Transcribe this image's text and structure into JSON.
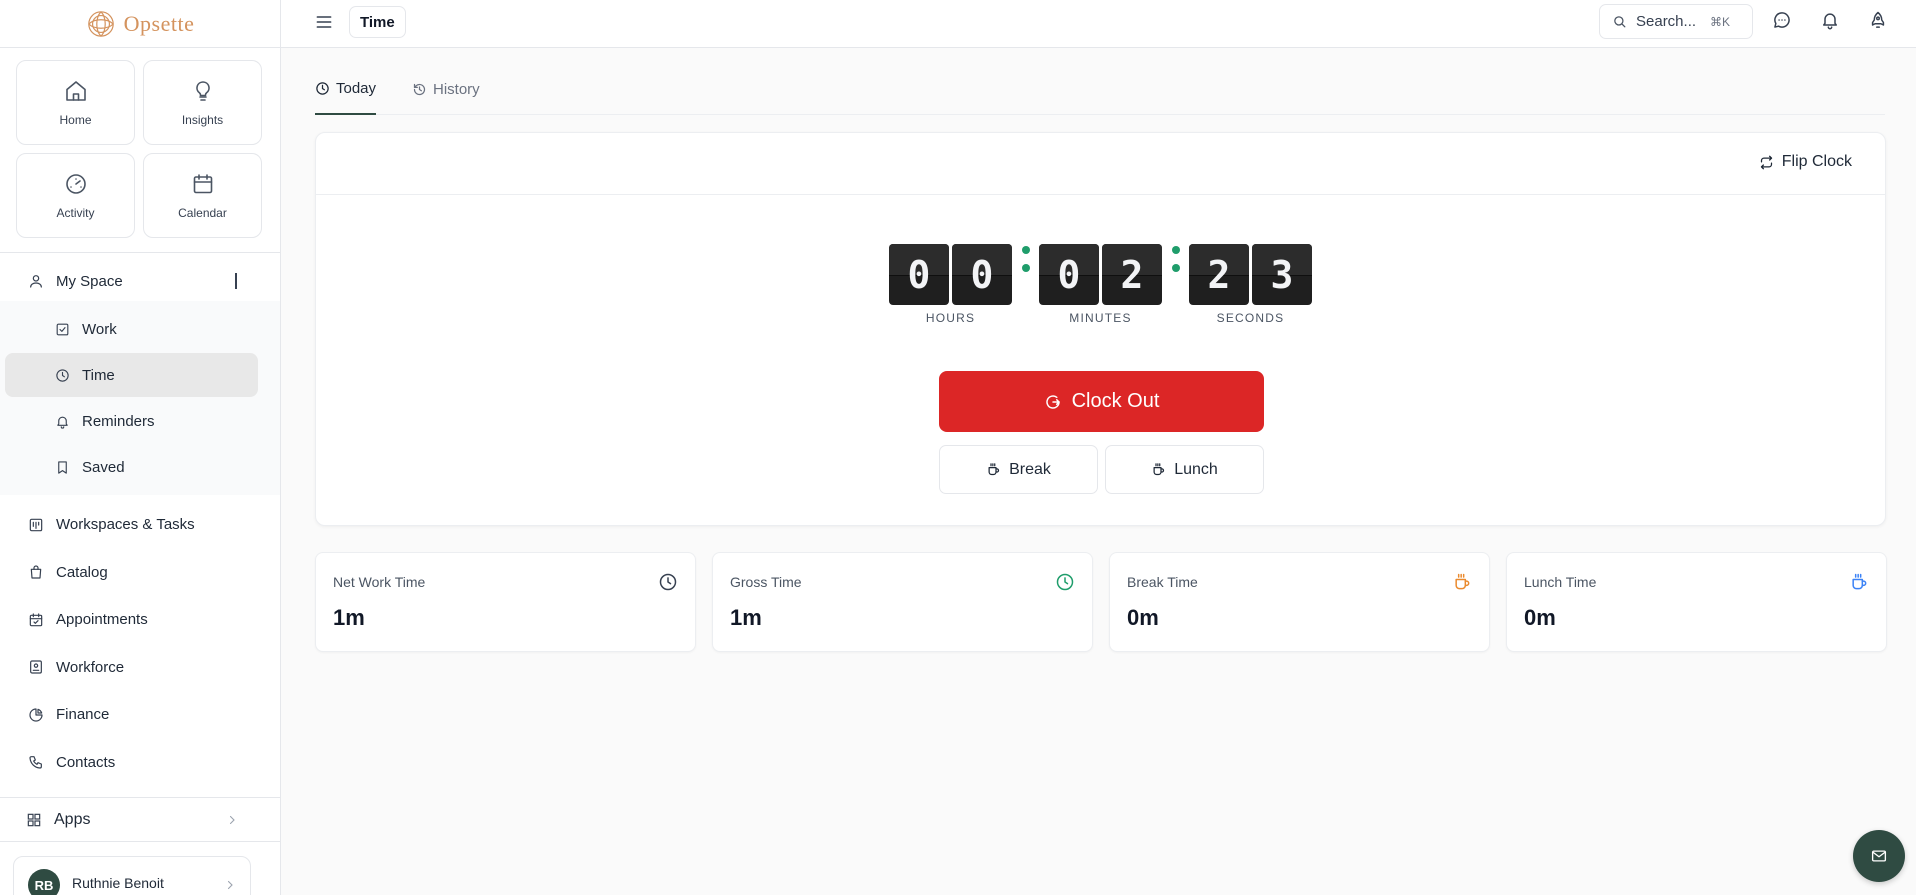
{
  "brand": {
    "name": "Opsette",
    "color": "#d4935e"
  },
  "topbar": {
    "page_title": "Time",
    "search_placeholder": "Search...",
    "search_shortcut": "⌘K"
  },
  "sidebar": {
    "quick": [
      {
        "label": "Home",
        "icon": "home-icon"
      },
      {
        "label": "Insights",
        "icon": "lightbulb-icon"
      },
      {
        "label": "Activity",
        "icon": "gauge-icon"
      },
      {
        "label": "Calendar",
        "icon": "calendar-icon"
      }
    ],
    "my_space": {
      "label": "My Space",
      "items": [
        {
          "label": "Work",
          "icon": "check-square-icon"
        },
        {
          "label": "Time",
          "icon": "clock-icon",
          "active": true
        },
        {
          "label": "Reminders",
          "icon": "bell-icon"
        },
        {
          "label": "Saved",
          "icon": "bookmark-icon"
        }
      ]
    },
    "nav": [
      {
        "label": "Workspaces & Tasks",
        "icon": "kanban-icon"
      },
      {
        "label": "Catalog",
        "icon": "shopping-bag-icon"
      },
      {
        "label": "Appointments",
        "icon": "calendar-check-icon"
      },
      {
        "label": "Workforce",
        "icon": "id-card-icon"
      },
      {
        "label": "Finance",
        "icon": "pie-chart-icon"
      },
      {
        "label": "Contacts",
        "icon": "phone-icon"
      }
    ],
    "apps_label": "Apps",
    "user": {
      "initials": "RB",
      "name": "Ruthnie Benoit"
    }
  },
  "tabs": [
    {
      "label": "Today",
      "active": true
    },
    {
      "label": "History",
      "active": false
    }
  ],
  "clock": {
    "flip_toggle_label": "Flip Clock",
    "hours": [
      "0",
      "0"
    ],
    "minutes": [
      "0",
      "2"
    ],
    "seconds": [
      "2",
      "3"
    ],
    "units": {
      "hours": "HOURS",
      "minutes": "MINUTES",
      "seconds": "SECONDS"
    },
    "clock_out_label": "Clock Out",
    "break_label": "Break",
    "lunch_label": "Lunch",
    "separator_color": "#1f9d6b",
    "clock_out_color": "#dc2626"
  },
  "stats": [
    {
      "label": "Net Work Time",
      "value": "1m",
      "icon": "clock-icon",
      "icon_color": "#374151"
    },
    {
      "label": "Gross Time",
      "value": "1m",
      "icon": "clock-icon",
      "icon_color": "#1f9d6b"
    },
    {
      "label": "Break Time",
      "value": "0m",
      "icon": "coffee-icon",
      "icon_color": "#ea8a2e"
    },
    {
      "label": "Lunch Time",
      "value": "0m",
      "icon": "coffee-icon",
      "icon_color": "#3b82f6"
    }
  ]
}
